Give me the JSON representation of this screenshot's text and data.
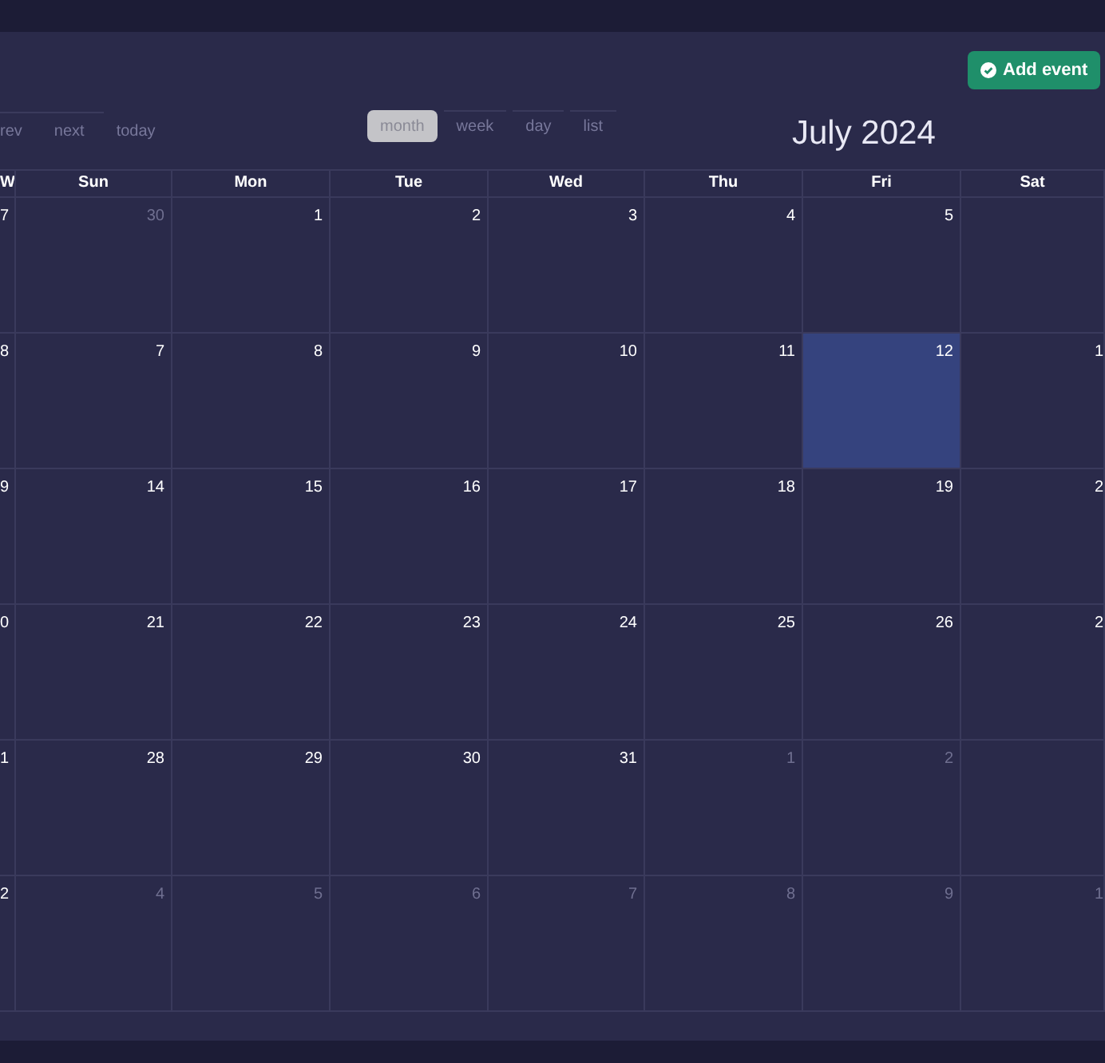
{
  "add_button": {
    "label": "Add event"
  },
  "nav_buttons": [
    {
      "label": "rev"
    },
    {
      "label": "next"
    },
    {
      "label": "today"
    }
  ],
  "views": [
    {
      "label": "month",
      "selected": true
    },
    {
      "label": "week",
      "selected": false
    },
    {
      "label": "day",
      "selected": false
    },
    {
      "label": "list",
      "selected": false
    }
  ],
  "title": "July 2024",
  "columns": [
    "W",
    "Sun",
    "Mon",
    "Tue",
    "Wed",
    "Thu",
    "Fri",
    "Sat"
  ],
  "weeks": [
    {
      "week": "7",
      "days": [
        {
          "label": "30",
          "muted": true,
          "today": false
        },
        {
          "label": "1",
          "muted": false,
          "today": false
        },
        {
          "label": "2",
          "muted": false,
          "today": false
        },
        {
          "label": "3",
          "muted": false,
          "today": false
        },
        {
          "label": "4",
          "muted": false,
          "today": false
        },
        {
          "label": "5",
          "muted": false,
          "today": false
        },
        {
          "today": false
        }
      ]
    },
    {
      "week": "8",
      "days": [
        {
          "label": "7",
          "muted": false,
          "today": false
        },
        {
          "label": "8",
          "muted": false,
          "today": false
        },
        {
          "label": "9",
          "muted": false,
          "today": false
        },
        {
          "label": "10",
          "muted": false,
          "today": false
        },
        {
          "label": "11",
          "muted": false,
          "today": false
        },
        {
          "label": "12",
          "muted": false,
          "today": true
        },
        {
          "label": "1",
          "muted": false,
          "today": false
        }
      ]
    },
    {
      "week": "9",
      "days": [
        {
          "label": "14",
          "muted": false,
          "today": false
        },
        {
          "label": "15",
          "muted": false,
          "today": false
        },
        {
          "label": "16",
          "muted": false,
          "today": false
        },
        {
          "label": "17",
          "muted": false,
          "today": false
        },
        {
          "label": "18",
          "muted": false,
          "today": false
        },
        {
          "label": "19",
          "muted": false,
          "today": false
        },
        {
          "label": "2",
          "muted": false,
          "today": false
        }
      ]
    },
    {
      "week": "0",
      "days": [
        {
          "label": "21",
          "muted": false,
          "today": false
        },
        {
          "label": "22",
          "muted": false,
          "today": false
        },
        {
          "label": "23",
          "muted": false,
          "today": false
        },
        {
          "label": "24",
          "muted": false,
          "today": false
        },
        {
          "label": "25",
          "muted": false,
          "today": false
        },
        {
          "label": "26",
          "muted": false,
          "today": false
        },
        {
          "label": "2",
          "muted": false,
          "today": false
        }
      ]
    },
    {
      "week": "1",
      "days": [
        {
          "label": "28",
          "muted": false,
          "today": false
        },
        {
          "label": "29",
          "muted": false,
          "today": false
        },
        {
          "label": "30",
          "muted": false,
          "today": false
        },
        {
          "label": "31",
          "muted": false,
          "today": false
        },
        {
          "label": "1",
          "muted": true,
          "today": false
        },
        {
          "label": "2",
          "muted": true,
          "today": false
        },
        {
          "today": false
        }
      ]
    },
    {
      "week": "2",
      "days": [
        {
          "label": "4",
          "muted": true,
          "today": false
        },
        {
          "label": "5",
          "muted": true,
          "today": false
        },
        {
          "label": "6",
          "muted": true,
          "today": false
        },
        {
          "label": "7",
          "muted": true,
          "today": false
        },
        {
          "label": "8",
          "muted": true,
          "today": false
        },
        {
          "label": "9",
          "muted": true,
          "today": false
        },
        {
          "label": "1",
          "muted": true,
          "today": false
        }
      ]
    }
  ]
}
